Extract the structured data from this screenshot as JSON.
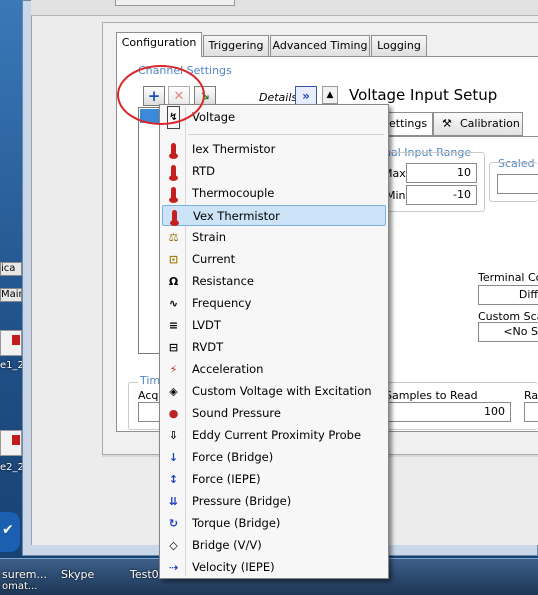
{
  "taskbar": {
    "items": [
      "surem...",
      "Skype",
      "Test0"
    ],
    "sub_label": "omat..."
  },
  "desktop": {
    "tiles": [
      "ica",
      "Main"
    ],
    "icon_labels": [
      "e1_2",
      "e2_2"
    ]
  },
  "tabs": [
    "Configuration",
    "Triggering",
    "Advanced Timing",
    "Logging"
  ],
  "channel_settings": {
    "group_label": "Channel Settings",
    "details_label": "Details",
    "add_icon": "plus-icon",
    "remove_icon": "x-icon"
  },
  "setup": {
    "title": "Voltage Input Setup",
    "subtabs": [
      "Settings",
      "Calibration"
    ],
    "signal_range_label": "gnal Input Range",
    "max_label": "Max",
    "max_value": "10",
    "min_label": "Min",
    "min_value": "-10",
    "scaled_label": "Scaled U",
    "terminal_label": "Terminal Co",
    "terminal_value": "Diff",
    "custom_scaling_label": "Custom Scali",
    "custom_scaling_value": "<No S"
  },
  "timing": {
    "group_label": "Timi",
    "acq_label": "Acqu",
    "samples_label": "Samples to Read",
    "samples_value": "100",
    "rate_label": "Ra"
  },
  "menu": {
    "items": [
      {
        "label": "Voltage",
        "icon": "voltage-icon"
      },
      {
        "label": "Iex Thermistor",
        "icon": "thermometer-icon"
      },
      {
        "label": "RTD",
        "icon": "thermometer-icon"
      },
      {
        "label": "Thermocouple",
        "icon": "thermometer-icon"
      },
      {
        "label": "Vex Thermistor",
        "icon": "thermometer-icon"
      },
      {
        "label": "Strain",
        "icon": "strain-icon"
      },
      {
        "label": "Current",
        "icon": "current-icon"
      },
      {
        "label": "Resistance",
        "icon": "resistance-icon"
      },
      {
        "label": "Frequency",
        "icon": "frequency-icon"
      },
      {
        "label": "LVDT",
        "icon": "lvdt-icon"
      },
      {
        "label": "RVDT",
        "icon": "rvdt-icon"
      },
      {
        "label": "Acceleration",
        "icon": "acceleration-icon"
      },
      {
        "label": "Custom Voltage with Excitation",
        "icon": "custom-voltage-icon"
      },
      {
        "label": "Sound Pressure",
        "icon": "microphone-icon"
      },
      {
        "label": "Eddy Current Proximity Probe",
        "icon": "probe-icon"
      },
      {
        "label": "Force (Bridge)",
        "icon": "force-icon"
      },
      {
        "label": "Force (IEPE)",
        "icon": "force-iepe-icon"
      },
      {
        "label": "Pressure (Bridge)",
        "icon": "pressure-icon"
      },
      {
        "label": "Torque (Bridge)",
        "icon": "torque-icon"
      },
      {
        "label": "Bridge (V/V)",
        "icon": "bridge-icon"
      },
      {
        "label": "Velocity (IEPE)",
        "icon": "velocity-icon"
      }
    ],
    "selected": "Vex Thermistor"
  },
  "colors": {
    "accent": "#4f86c6",
    "selection": "#cde3f7",
    "annotation": "#d9262b"
  }
}
